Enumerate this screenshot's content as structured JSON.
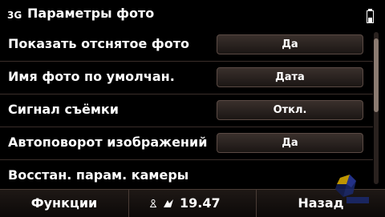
{
  "status": {
    "network": "3G",
    "title": "Параметры фото"
  },
  "settings": [
    {
      "label": "Показать отснятое фото",
      "value": "Да"
    },
    {
      "label": "Имя фото по умолчан.",
      "value": "Дата"
    },
    {
      "label": "Сигнал съёмки",
      "value": "Откл."
    },
    {
      "label": "Автоповорот изображений",
      "value": "Да"
    },
    {
      "label": "Восстан. парам. камеры",
      "value": ""
    }
  ],
  "softkeys": {
    "left": "Функции",
    "right": "Назад",
    "clock": "19.47"
  },
  "icons": {
    "battery": "battery-icon",
    "profile": "profile-icon",
    "alarm": "alarm-icon"
  },
  "colors": {
    "background": "#000000",
    "accent": "#5a4a44"
  }
}
